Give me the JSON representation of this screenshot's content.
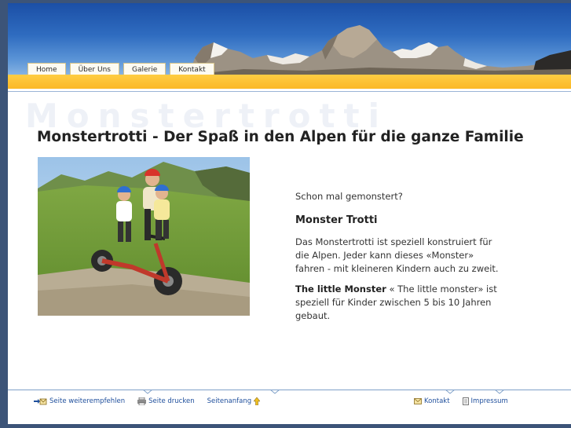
{
  "nav": {
    "items": [
      "Home",
      "Über Uns",
      "Galerie",
      "Kontakt"
    ]
  },
  "watermark": "Monstertrotti",
  "page_title": "Monstertrotti - Der Spaß in den Alpen für die ganze Familie",
  "content": {
    "intro": "Schon mal gemonstert?",
    "subheading": "Monster Trotti",
    "para1": "Das Monstertrotti ist speziell konstruiert für die Alpen. Jeder kann dieses «Monster» fahren - mit kleineren Kindern auch zu zweit.",
    "para2_bold": "The little Monster",
    "para2_rest": " « The little monster» ist speziell für Kinder zwischen 5 bis 10 Jahren gebaut."
  },
  "footer": {
    "recommend": "Seite weiterempfehlen",
    "print": "Seite drucken",
    "top": "Seitenanfang",
    "contact": "Kontakt",
    "impressum": "Impressum"
  }
}
